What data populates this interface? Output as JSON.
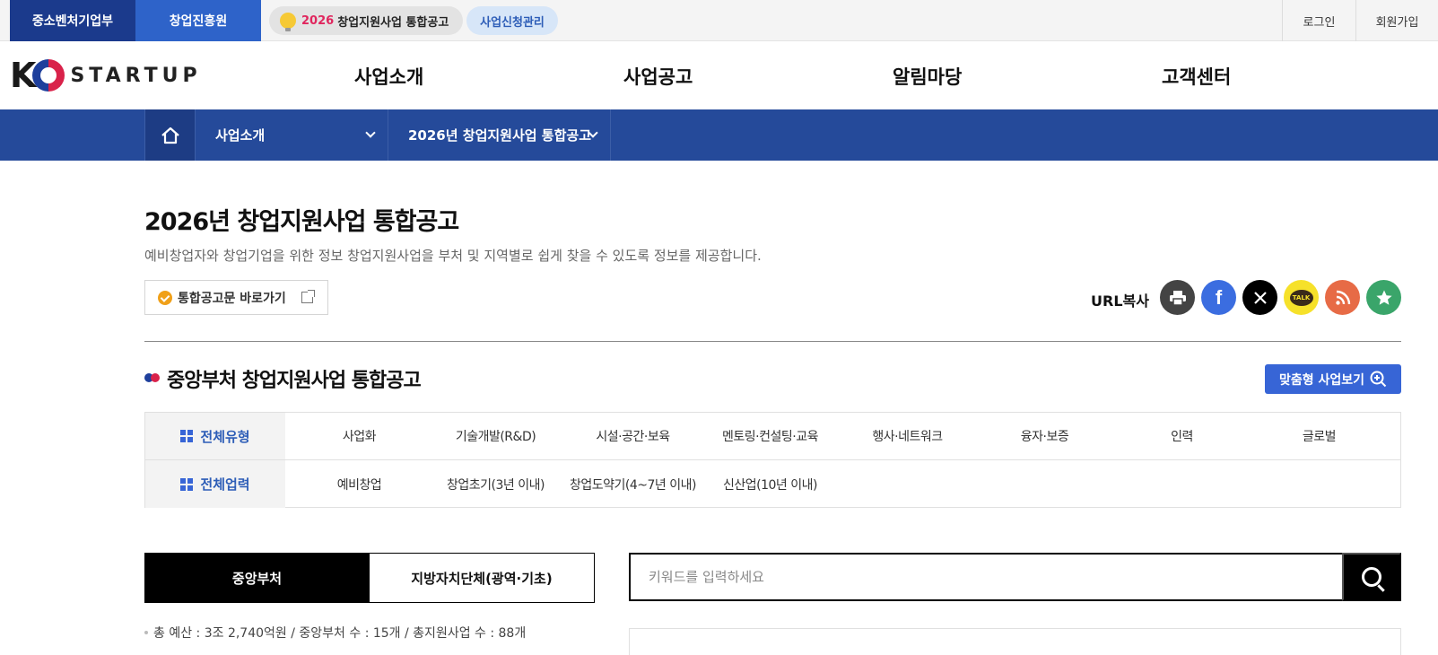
{
  "topbar": {
    "ministry": "중소벤처기업부",
    "agency": "창업진흥원",
    "notice_year": "2026",
    "notice_text": "창업지원사업 통합공고",
    "apply_manage": "사업신청관리",
    "login": "로그인",
    "join": "회원가입"
  },
  "logo": {
    "k": "K",
    "text": "STARTUP"
  },
  "gnb": [
    "사업소개",
    "사업공고",
    "알림마당",
    "고객센터"
  ],
  "breadcrumb": {
    "level1": "사업소개",
    "level2": "2026년 창업지원사업 통합공고"
  },
  "page": {
    "title": "2026년 창업지원사업 통합공고",
    "desc": "예비창업자와 창업기업을 위한 정보 창업지원사업을 부처 및 지역별로 쉽게 찾을 수 있도록 정보를 제공합니다.",
    "shortcut": "통합공고문 바로가기",
    "url_copy": "URL복사"
  },
  "share": {
    "colors": {
      "print": "#444444",
      "facebook": "#3b6de0",
      "x": "#000000",
      "kakao": "#f6e12a",
      "rss": "#e76b46",
      "favorite": "#3aa56a"
    },
    "kakao_label": "TALK"
  },
  "section": {
    "title": "중앙부처 창업지원사업 통합공고",
    "custom_button": "맞춤형 사업보기"
  },
  "filters": {
    "type_head": "전체유형",
    "types": [
      "사업화",
      "기술개발(R&D)",
      "시설·공간·보육",
      "멘토링·컨설팅·교육",
      "행사·네트워크",
      "융자·보증",
      "인력",
      "글로벌"
    ],
    "age_head": "전체업력",
    "ages": [
      "예비창업",
      "창업초기(3년 이내)",
      "창업도약기(4~7년 이내)",
      "신산업(10년 이내)"
    ]
  },
  "tabs": {
    "central": "중앙부처",
    "local": "지방자치단체(광역·기초)"
  },
  "search": {
    "placeholder": "키워드를 입력하세요"
  },
  "summary": "총 예산 : 3조 2,740억원 / 중앙부처 수 : 15개 / 총지원사업 수 : 88개",
  "colors": {
    "primary_blue": "#254a9a",
    "accent_blue": "#3765d6",
    "brand_red": "#d9224a"
  }
}
